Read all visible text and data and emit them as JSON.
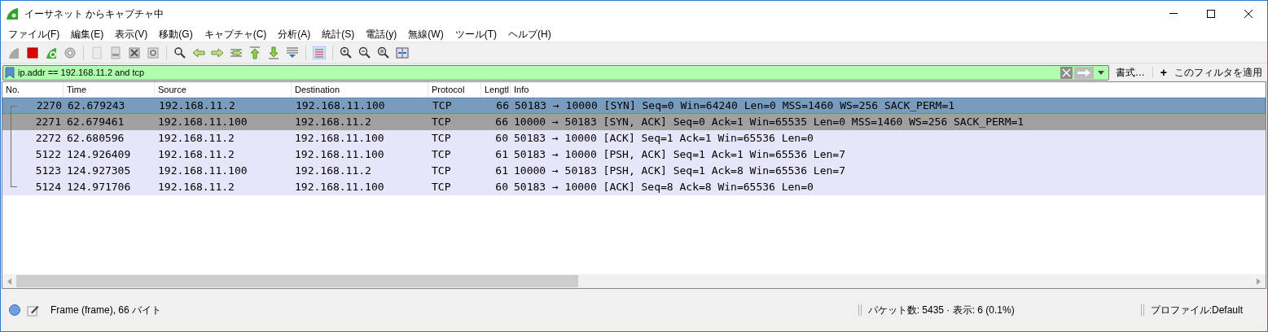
{
  "window": {
    "title": "イーサネット からキャプチャ中"
  },
  "menu": [
    "ファイル(F)",
    "編集(E)",
    "表示(V)",
    "移動(G)",
    "キャプチャ(C)",
    "分析(A)",
    "統計(S)",
    "電話(y)",
    "無線(W)",
    "ツール(T)",
    "ヘルプ(H)"
  ],
  "filter": {
    "value": "ip.addr == 192.168.11.2 and tcp",
    "format_button": "書式…",
    "add_button": "+",
    "apply_label": "このフィルタを適用"
  },
  "table": {
    "columns": [
      "No.",
      "Time",
      "Source",
      "Destination",
      "Protocol",
      "Lengtl",
      "Info"
    ],
    "rows": [
      {
        "selected": true,
        "cells": [
          "2270",
          "62.679243",
          "192.168.11.2",
          "192.168.11.100",
          "TCP",
          "66",
          "50183 → 10000 [SYN] Seq=0 Win=64240 Len=0 MSS=1460 WS=256 SACK_PERM=1"
        ]
      },
      {
        "selected": false,
        "color": "#a0a0a0",
        "cells": [
          "2271",
          "62.679461",
          "192.168.11.100",
          "192.168.11.2",
          "TCP",
          "66",
          "10000 → 50183 [SYN, ACK] Seq=0 Ack=1 Win=65535 Len=0 MSS=1460 WS=256 SACK_PERM=1"
        ]
      },
      {
        "selected": false,
        "color": "#e6e6fa",
        "cells": [
          "2272",
          "62.680596",
          "192.168.11.2",
          "192.168.11.100",
          "TCP",
          "60",
          "50183 → 10000 [ACK] Seq=1 Ack=1 Win=65536 Len=0"
        ]
      },
      {
        "selected": false,
        "color": "#e6e6fa",
        "cells": [
          "5122",
          "124.926409",
          "192.168.11.2",
          "192.168.11.100",
          "TCP",
          "61",
          "50183 → 10000 [PSH, ACK] Seq=1 Ack=1 Win=65536 Len=7"
        ]
      },
      {
        "selected": false,
        "color": "#e6e6fa",
        "cells": [
          "5123",
          "124.927305",
          "192.168.11.100",
          "192.168.11.2",
          "TCP",
          "61",
          "10000 → 50183 [PSH, ACK] Seq=1 Ack=8 Win=65536 Len=7"
        ]
      },
      {
        "selected": false,
        "color": "#e6e6fa",
        "cells": [
          "5124",
          "124.971706",
          "192.168.11.2",
          "192.168.11.100",
          "TCP",
          "60",
          "50183 → 10000 [ACK] Seq=8 Ack=8 Win=65536 Len=0"
        ]
      }
    ]
  },
  "status_bar": {
    "frame_info": "Frame (frame), 66 バイト",
    "packets": "パケット数: 5435 · 表示: 6 (0.1%)",
    "profile": "プロファイル:Default"
  }
}
